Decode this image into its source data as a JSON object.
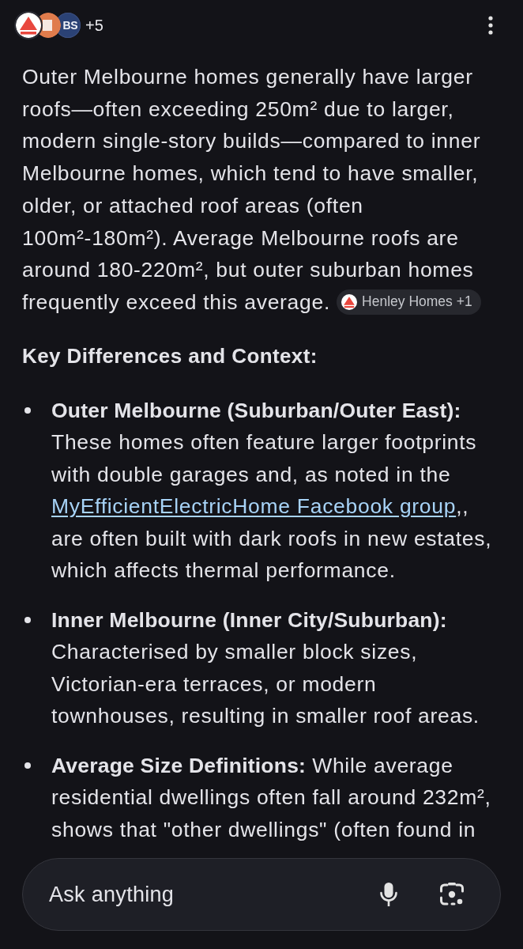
{
  "header": {
    "sources": [
      {
        "kind": "triangle"
      },
      {
        "kind": "square"
      },
      {
        "kind": "initials",
        "label": "BS"
      }
    ],
    "more_count": "+5"
  },
  "answer": {
    "paragraph": "Outer Melbourne homes generally have larger roofs—often exceeding 250m² due to larger, modern single-story builds—compared to inner Melbourne homes, which tend to have smaller, older, or attached roof areas (often 100m²-180m²). Average Melbourne roofs are around 180-220m², but outer suburban homes frequently exceed this average.",
    "citation": {
      "label": "Henley Homes +1"
    }
  },
  "section_heading": "Key Differences and Context:",
  "bullets": [
    {
      "text": "**Outer Melbourne (Suburban/Outer East):** These homes often feature larger footprints with double garages and, as noted in the",
      "link": "MyEfficientElectricHome Facebook group",
      "text_after": ",, are often built with dark roofs in new estates, which affects thermal performance."
    },
    {
      "text": "**Inner Melbourne (Inner City/Suburban):** Characterised by smaller block sizes, Victorian-era terraces, or modern townhouses, resulting in smaller roof areas."
    },
    {
      "text": "**Average Size Definitions:** While average residential dwellings often fall around 232m², shows that \"other dwellings\" (often found in"
    }
  ],
  "input": {
    "placeholder": "Ask anything"
  }
}
